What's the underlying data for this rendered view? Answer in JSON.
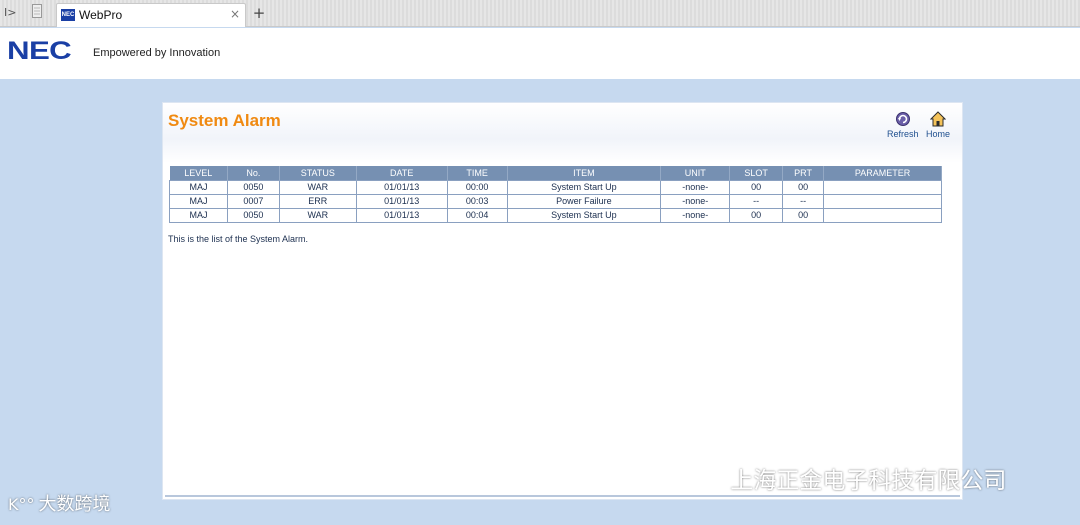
{
  "browser": {
    "tab_title": "WebPro",
    "favicon_text": "NEC",
    "close_symbol": "×",
    "newtab_symbol": "+"
  },
  "header": {
    "logo": "NEC",
    "tagline": "Empowered by Innovation"
  },
  "page": {
    "title": "System Alarm",
    "refresh_label": "Refresh",
    "home_label": "Home",
    "caption": "This is the list of the System Alarm."
  },
  "table": {
    "columns": [
      "LEVEL",
      "No.",
      "STATUS",
      "DATE",
      "TIME",
      "ITEM",
      "UNIT",
      "SLOT",
      "PRT",
      "PARAMETER"
    ],
    "rows": [
      [
        "MAJ",
        "0050",
        "WAR",
        "01/01/13",
        "00:00",
        "System Start Up",
        "-none-",
        "00",
        "00",
        ""
      ],
      [
        "MAJ",
        "0007",
        "ERR",
        "01/01/13",
        "00:03",
        "Power Failure",
        "-none-",
        "--",
        "--",
        ""
      ],
      [
        "MAJ",
        "0050",
        "WAR",
        "01/01/13",
        "00:04",
        "System Start Up",
        "-none-",
        "00",
        "00",
        ""
      ]
    ]
  },
  "watermarks": {
    "left": "大数跨境",
    "right": "上海正金电子科技有限公司"
  },
  "colors": {
    "title": "#f08a12",
    "brand": "#1a3fa5",
    "table_header": "#7690b2",
    "background": "#c6d9ef"
  }
}
